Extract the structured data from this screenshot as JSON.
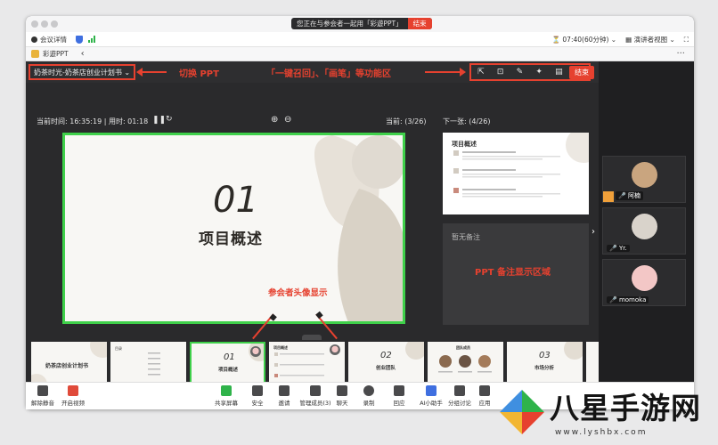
{
  "titlebar": {
    "share_notice": "您正在与参会者一起用「彩遊PPT」",
    "end_label": "结束"
  },
  "meetbar": {
    "info_label": "会议详情",
    "time": "07:40(60分钟)",
    "view_label": "演讲者视图"
  },
  "apptab": {
    "app_name": "彩遊PPT",
    "more": "···"
  },
  "toolbar": {
    "ppt_name": "奶茶时光-奶茶店创业计划书 ⌄",
    "switch_annotation": "切换 PPT",
    "tools_annotation": "「一键召回」、「画笔」等功能区",
    "end_label": "结束",
    "tool_icons": [
      "export-icon",
      "recall-icon",
      "pen-icon",
      "laser-icon",
      "layout-icon",
      "settings-icon"
    ]
  },
  "stage": {
    "current_time_label": "当前时间: 16:35:19 | 用时: 01:18",
    "current_page_label": "当前: (3/26)",
    "next_label": "下一张: (4/26)",
    "slide_number": "01",
    "slide_title": "项目概述",
    "next_slide_title": "项目概述",
    "notes_empty": "暂无备注",
    "notes_annotation": "PPT 备注显示区域",
    "avatar_annotation": "参会者头像显示"
  },
  "thumbnails": [
    {
      "index": "1",
      "title": "奶茶店创业计划书",
      "kind": "cover"
    },
    {
      "index": "2",
      "title": "目录",
      "kind": "toc"
    },
    {
      "index": "3",
      "title": "项目概述",
      "kind": "section",
      "number": "01"
    },
    {
      "index": "4",
      "title": "项目概述",
      "kind": "content"
    },
    {
      "index": "5",
      "title": "创业团队",
      "kind": "section",
      "number": "02"
    },
    {
      "index": "6",
      "title": "团队成员",
      "kind": "team"
    },
    {
      "index": "7",
      "title": "市场分析",
      "kind": "section",
      "number": "03"
    },
    {
      "index": "8",
      "title": "",
      "kind": "partial"
    }
  ],
  "participants": [
    {
      "name": "阿楠",
      "color": "#c9a57f"
    },
    {
      "name": "Yr.",
      "color": "#d9d3cb"
    },
    {
      "name": "momoka",
      "color": "#f3c7c6"
    }
  ],
  "controls": [
    {
      "label": "解除静音",
      "icon": "mic-icon"
    },
    {
      "label": "开启视频",
      "icon": "video-icon"
    },
    {
      "label": "共享屏幕",
      "icon": "share-screen-icon"
    },
    {
      "label": "安全",
      "icon": "security-icon"
    },
    {
      "label": "邀请",
      "icon": "invite-icon"
    },
    {
      "label": "管理成员(3)",
      "icon": "members-icon"
    },
    {
      "label": "聊天",
      "icon": "chat-icon"
    },
    {
      "label": "录制",
      "icon": "record-icon"
    },
    {
      "label": "回应",
      "icon": "react-icon"
    },
    {
      "label": "AI小助手",
      "icon": "ai-icon"
    },
    {
      "label": "分组讨论",
      "icon": "breakout-icon"
    },
    {
      "label": "应用",
      "icon": "apps-icon"
    }
  ],
  "watermark": {
    "text": "八星手游网",
    "url": "www.lyshbx.com"
  }
}
